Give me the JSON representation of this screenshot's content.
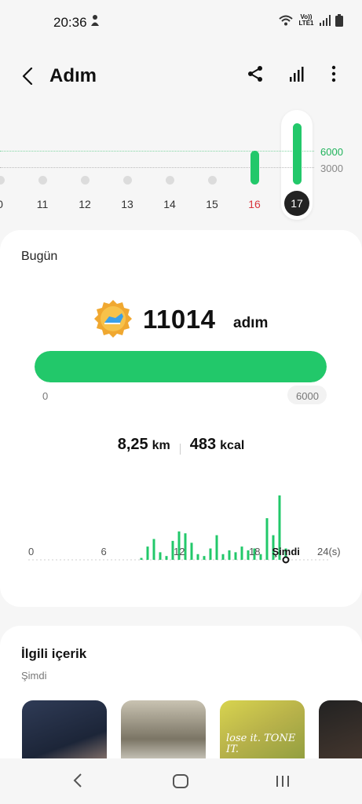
{
  "status_bar": {
    "time": "20:36",
    "lte": "Vo)) LTE1"
  },
  "header": {
    "title": "Adım"
  },
  "day_strip": {
    "goal_6000": "6000",
    "goal_3000": "3000",
    "days": [
      {
        "label": "0",
        "steps": 0,
        "highlight": "none"
      },
      {
        "label": "11",
        "steps": 0,
        "highlight": "none"
      },
      {
        "label": "12",
        "steps": 0,
        "highlight": "none"
      },
      {
        "label": "13",
        "steps": 0,
        "highlight": "none"
      },
      {
        "label": "14",
        "steps": 1500,
        "highlight": "none"
      },
      {
        "label": "15",
        "steps": 0,
        "highlight": "none"
      },
      {
        "label": "16",
        "steps": 6000,
        "highlight": "red"
      },
      {
        "label": "17",
        "steps": 11014,
        "highlight": "selected"
      }
    ]
  },
  "today": {
    "section_title": "Bugün",
    "steps": "11014",
    "steps_unit": "adım",
    "progress_min": "0",
    "progress_max": "6000",
    "progress_fraction": 1.0,
    "distance_value": "8,25",
    "distance_unit": "km",
    "calories_value": "483",
    "calories_unit": "kcal",
    "hourly_axis": [
      "0",
      "6",
      "12",
      "18",
      "Şimdi",
      "24(s)"
    ]
  },
  "chart_data": {
    "type": "bar",
    "x": [
      9.0,
      9.5,
      10.0,
      10.5,
      11.0,
      11.5,
      12.0,
      12.5,
      13.0,
      13.5,
      14.0,
      14.5,
      15.0,
      15.5,
      16.0,
      16.5,
      17.0,
      17.5,
      18.0,
      18.5,
      19.0,
      19.5,
      20.0,
      20.5
    ],
    "values": [
      5,
      35,
      55,
      20,
      10,
      50,
      75,
      70,
      45,
      15,
      10,
      30,
      65,
      15,
      25,
      20,
      35,
      25,
      30,
      15,
      110,
      65,
      170,
      30
    ],
    "xlim": [
      0,
      24
    ],
    "xticks": [
      "0",
      "6",
      "12",
      "18",
      "Şimdi",
      "24(s)"
    ]
  },
  "related": {
    "title": "İlgili içerik",
    "subtitle": "Şimdi",
    "thumb3_text": "lose it. TONE IT."
  },
  "colors": {
    "accent": "#22c86a",
    "red": "#d9363e",
    "dark": "#222222"
  }
}
